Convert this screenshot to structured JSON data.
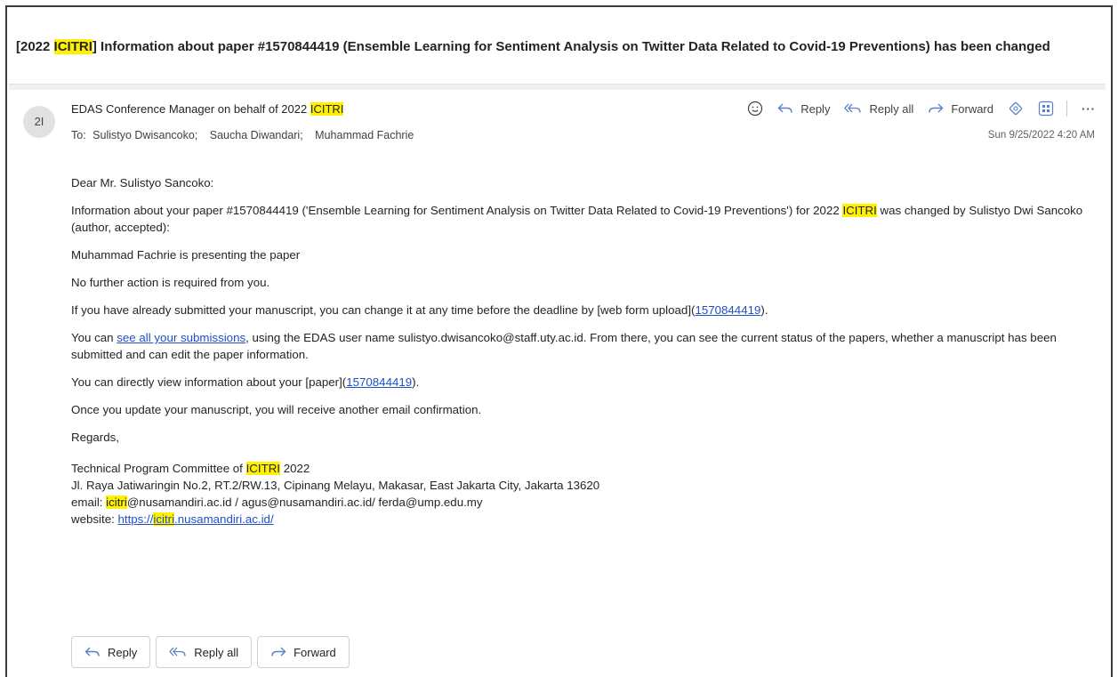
{
  "subject": {
    "prefix": "[2022 ",
    "highlight": "ICITRI",
    "rest": "] Information about paper #1570844419 (Ensemble Learning for Sentiment Analysis on Twitter Data Related to Covid-19 Preventions) has been changed"
  },
  "header": {
    "avatar_initials": "2I",
    "sender_prefix": "EDAS Conference Manager on behalf of 2022 ",
    "sender_highlight": "ICITRI",
    "to_label": "To:",
    "recipients": [
      "Sulistyo Dwisancoko;",
      "Saucha Diwandari;",
      "Muhammad Fachrie"
    ],
    "date": "Sun 9/25/2022 4:20 AM",
    "actions": {
      "reply": "Reply",
      "reply_all": "Reply all",
      "forward": "Forward",
      "more": "···"
    }
  },
  "body": {
    "greeting": "Dear Mr. Sulistyo Sancoko:",
    "para1_a": "Information about your paper #1570844419 ('Ensemble Learning for Sentiment Analysis on Twitter Data Related to Covid-19 Preventions') for 2022 ",
    "para1_hl": "ICITRI",
    "para1_b": " was changed by Sulistyo Dwi Sancoko (author, accepted):",
    "para2": "Muhammad Fachrie is presenting the paper",
    "para3": "No further action is required from you.",
    "para4_a": "If you have already submitted your manuscript, you can change it at any time before the deadline by [web form upload](",
    "para4_link": "1570844419",
    "para4_b": ").",
    "para5_a": "You can ",
    "para5_link": "see all your submissions",
    "para5_b": ", using the EDAS user name sulistyo.dwisancoko@staff.uty.ac.id. From there, you can see the current status of the papers, whether a manuscript has been submitted and can edit the paper information.",
    "para6_a": "You can directly view information about your [paper](",
    "para6_link": "1570844419",
    "para6_b": ").",
    "para7": "Once you update your manuscript, you will receive another email confirmation.",
    "regards": "Regards,",
    "sig_line1_a": "Technical Program Committee of ",
    "sig_line1_hl": "ICITRI",
    "sig_line1_b": " 2022",
    "sig_line2": "Jl. Raya Jatiwaringin No.2, RT.2/RW.13, Cipinang Melayu, Makasar, East Jakarta City, Jakarta 13620",
    "sig_email_label": "email: ",
    "sig_email_hl": "icitri",
    "sig_email_rest": "@nusamandiri.ac.id / agus@nusamandiri.ac.id/ ferda@ump.edu.my",
    "sig_web_label": "website: ",
    "sig_web_a": "https://",
    "sig_web_hl": "icitri",
    "sig_web_b": ".nusamandiri.ac.id/"
  },
  "footer": {
    "reply": "Reply",
    "reply_all": "Reply all",
    "forward": "Forward"
  },
  "colors": {
    "highlight": "#fff100",
    "link": "#1e50c8",
    "icon_accent": "#5b7fc8"
  }
}
